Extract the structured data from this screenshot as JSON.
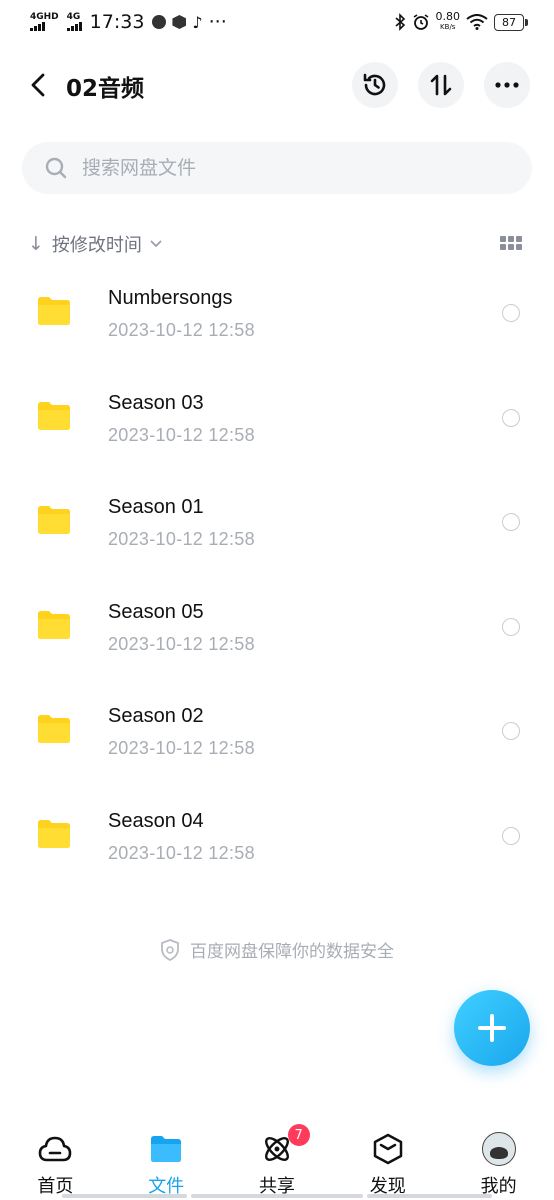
{
  "status_bar": {
    "sig1_label": "4GHD",
    "sig2_label": "4G",
    "time": "17:33",
    "more": "···",
    "net_speed": "0.80",
    "net_unit": "KB/s",
    "battery": "87"
  },
  "header": {
    "title": "02音频"
  },
  "search": {
    "placeholder": "搜索网盘文件"
  },
  "sort": {
    "label": "按修改时间"
  },
  "files": [
    {
      "name": "Numbersongs",
      "date": "2023-10-12  12:58"
    },
    {
      "name": "Season 03",
      "date": "2023-10-12  12:58"
    },
    {
      "name": "Season 01",
      "date": "2023-10-12  12:58"
    },
    {
      "name": "Season 05",
      "date": "2023-10-12  12:58"
    },
    {
      "name": "Season 02",
      "date": "2023-10-12  12:58"
    },
    {
      "name": "Season 04",
      "date": "2023-10-12  12:58"
    }
  ],
  "security_note": "百度网盘保障你的数据安全",
  "nav": {
    "items": [
      {
        "label": "首页"
      },
      {
        "label": "文件"
      },
      {
        "label": "共享"
      },
      {
        "label": "发现"
      },
      {
        "label": "我的"
      }
    ],
    "share_badge": "7"
  },
  "colors": {
    "accent": "#16a3f0",
    "folder": "#ffd21e",
    "badge": "#ff3b5c"
  }
}
